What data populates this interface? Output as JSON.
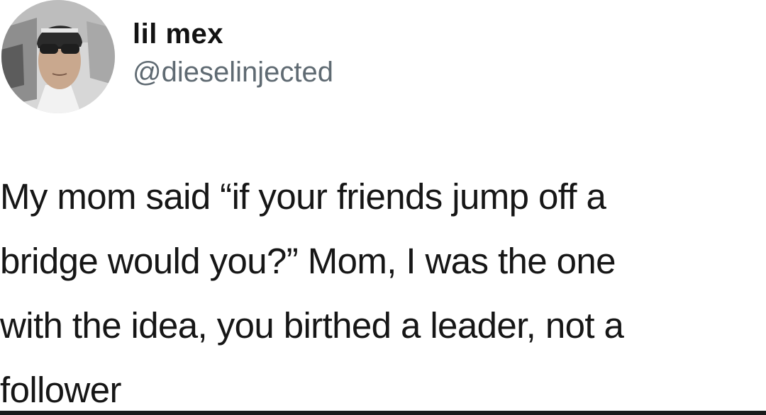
{
  "tweet": {
    "display_name": "lil mex",
    "handle": "@dieselinjected",
    "text": "My mom said “if your friends jump off a\nbridge would you?” Mom, I was the one\nwith the idea, you birthed a leader, not a\nfollower"
  },
  "icons": {
    "avatar": "profile-photo-avatar"
  }
}
